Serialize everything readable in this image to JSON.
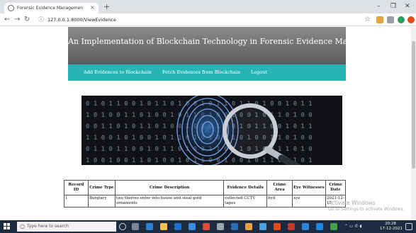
{
  "browser": {
    "tab_title": "Forensic Evidence Managemen",
    "tab_close": "×",
    "new_tab": "+",
    "window_controls": [
      "–",
      "❐",
      "✕"
    ],
    "url": "127.0.0.1:8000/ViewEvidence"
  },
  "site": {
    "title": "An Implementation of Blockchain Technology in Forensic Evidence Management",
    "nav": [
      "Add Evidences to Blockchain",
      "Fetch Evidences from Blockchain",
      "Logout"
    ]
  },
  "table": {
    "headers": [
      "Record ID",
      "Crime Type",
      "Crime Description",
      "Evidence Details",
      "Crime Area",
      "Eye Witnesses",
      "Crime Date"
    ],
    "rows": [
      [
        "1",
        "Burglary",
        "two theives enter into house and steal gold ornaments",
        "collected CCTV tapes",
        "hyd",
        "xyz",
        "2021-12-17"
      ]
    ]
  },
  "watermark": [
    "Activate Windows",
    "Go to Settings to activate Windows."
  ],
  "taskbar": {
    "search_placeholder": "Type here to search",
    "time": "20:28",
    "date": "17-12-2021"
  },
  "colors": {
    "nav_teal": "#26b5b5",
    "header_grey": "#707070",
    "taskbar": "#1c2b3f"
  }
}
